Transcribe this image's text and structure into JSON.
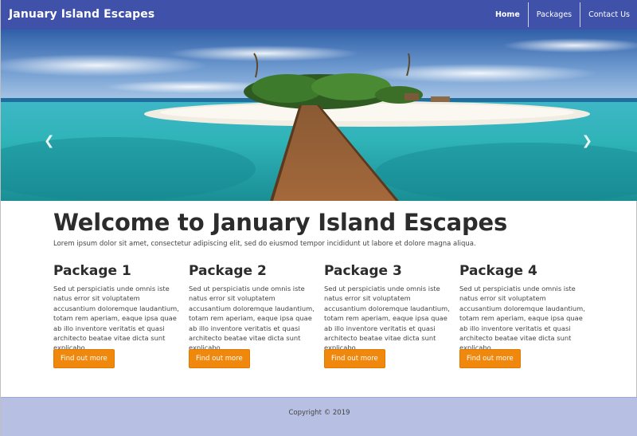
{
  "navbar": {
    "brand": "January Island Escapes",
    "items": [
      {
        "label": "Home",
        "active": true
      },
      {
        "label": "Packages",
        "active": false
      },
      {
        "label": "Contact Us",
        "active": false
      }
    ]
  },
  "hero": {
    "prev_icon": "chevron-left-icon",
    "next_icon": "chevron-right-icon",
    "slide_count": 3,
    "active_slide": 2
  },
  "welcome": {
    "title": "Welcome to January Island Escapes",
    "text": "Lorem ipsum dolor sit amet, consectetur adipiscing elit, sed do eiusmod tempor incididunt ut labore et dolore magna aliqua."
  },
  "packages": [
    {
      "title": "Package 1",
      "text": "Sed ut perspiciatis unde omnis iste natus error sit voluptatem accusantium doloremque laudantium, totam rem aperiam, eaque ipsa quae ab illo inventore veritatis et quasi architecto beatae vitae dicta sunt explicabo.",
      "button": "Find out more"
    },
    {
      "title": "Package 2",
      "text": "Sed ut perspiciatis unde omnis iste natus error sit voluptatem accusantium doloremque laudantium, totam rem aperiam, eaque ipsa quae ab illo inventore veritatis et quasi architecto beatae vitae dicta sunt explicabo.",
      "button": "Find out more"
    },
    {
      "title": "Package 3",
      "text": "Sed ut perspiciatis unde omnis iste natus error sit voluptatem accusantium doloremque laudantium, totam rem aperiam, eaque ipsa quae ab illo inventore veritatis et quasi architecto beatae vitae dicta sunt explicabo.",
      "button": "Find out more"
    },
    {
      "title": "Package 4",
      "text": "Sed ut perspiciatis unde omnis iste natus error sit voluptatem accusantium doloremque laudantium, totam rem aperiam, eaque ipsa quae ab illo inventore veritatis et quasi architecto beatae vitae dicta sunt explicabo.",
      "button": "Find out more"
    }
  ],
  "footer": {
    "copyright": "Copyright © 2019"
  },
  "colors": {
    "navbar": "#3f51a9",
    "button": "#f0880d",
    "footer": "#b7c0e2",
    "heading": "#2c2c2c"
  }
}
